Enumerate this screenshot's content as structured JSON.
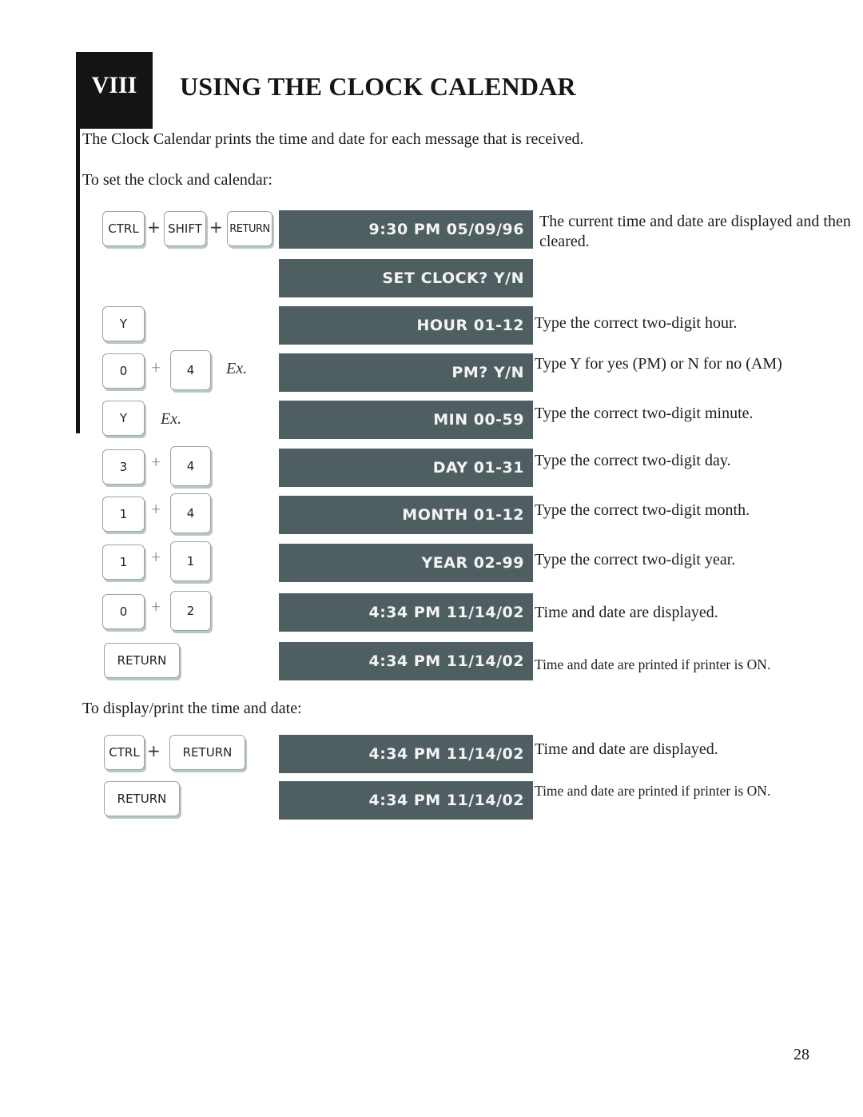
{
  "chapter": {
    "number": "VIII",
    "title": "USING THE CLOCK CALENDAR"
  },
  "intro": "The Clock Calendar prints the time and date for each message that is received.",
  "set_section": {
    "heading": "To set the clock and calendar:",
    "steps": [
      {
        "keys": [
          "CTRL",
          "SHIFT",
          "RETURN"
        ],
        "display": "9:30 PM 05/09/96",
        "description": "The current time and date are displayed and then cleared."
      },
      {
        "keys": [],
        "display": "SET CLOCK? Y/N",
        "description": ""
      },
      {
        "keys": [
          "Y"
        ],
        "display": "HOUR 01-12",
        "description": "Type the correct two-digit hour."
      },
      {
        "keys": [
          "0",
          "4"
        ],
        "example": "Ex.",
        "display": "PM? Y/N",
        "description": "Type Y for yes (PM) or N for no (AM)"
      },
      {
        "keys": [
          "Y"
        ],
        "example": "Ex.",
        "display": "MIN 00-59",
        "description": "Type the correct two-digit minute."
      },
      {
        "keys": [
          "3",
          "4"
        ],
        "display": "DAY 01-31",
        "description": "Type the correct two-digit day."
      },
      {
        "keys": [
          "1",
          "4"
        ],
        "display": "MONTH 01-12",
        "description": "Type the correct two-digit month."
      },
      {
        "keys": [
          "1",
          "1"
        ],
        "display": "YEAR 02-99",
        "description": "Type the correct two-digit year."
      },
      {
        "keys": [
          "0",
          "2"
        ],
        "display": "4:34 PM 11/14/02",
        "description": "Time and date are displayed."
      },
      {
        "keys": [
          "RETURN"
        ],
        "display": "4:34 PM 11/14/02",
        "description": "Time and date are printed if printer is ON."
      }
    ]
  },
  "display_section": {
    "heading": "To display/print the time and date:",
    "steps": [
      {
        "keys": [
          "CTRL",
          "RETURN"
        ],
        "display": "4:34 PM 11/14/02",
        "description": "Time and date are displayed."
      },
      {
        "keys": [
          "RETURN"
        ],
        "display": "4:34 PM 11/14/02",
        "description": "Time and date are printed if printer is ON."
      }
    ]
  },
  "plus_sign": "+",
  "page_number": "28",
  "colors": {
    "display_bg": "#4f5e61",
    "chapter_bg": "#141414"
  }
}
